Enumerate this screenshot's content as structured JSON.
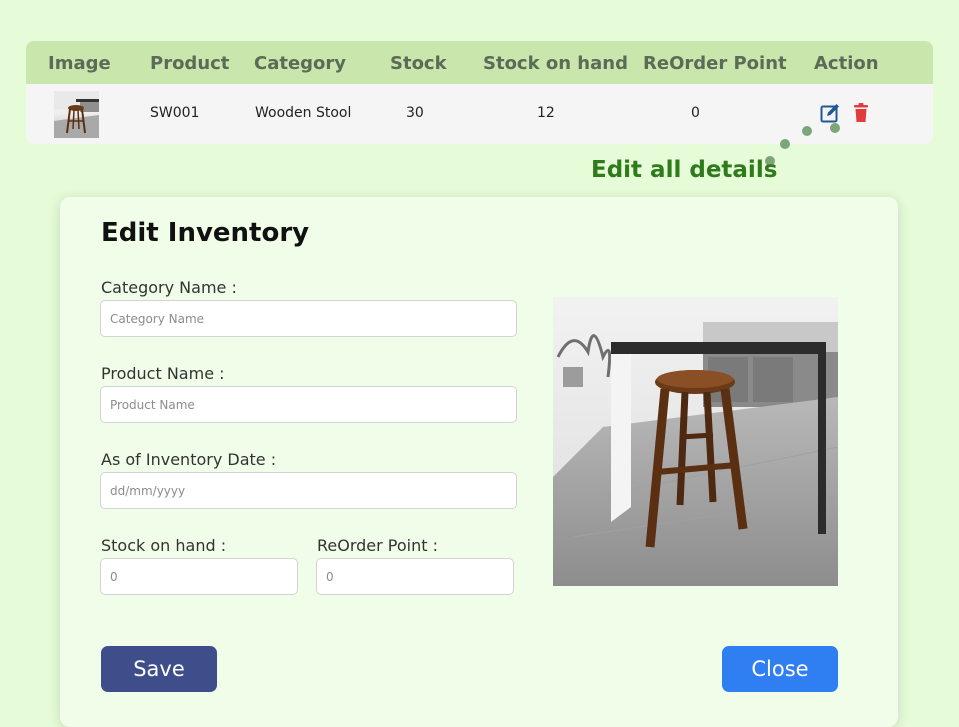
{
  "table": {
    "headers": [
      "Image",
      "Product",
      "Category",
      "Stock",
      "Stock on hand",
      "ReOrder Point",
      "Action"
    ],
    "rows": [
      {
        "product": "SW001",
        "category": "Wooden Stool",
        "stock": "30",
        "stock_on_hand": "12",
        "reorder_point": "0"
      }
    ],
    "action_icons": [
      "edit-icon",
      "trash-icon"
    ]
  },
  "annotation": {
    "text": "Edit all details",
    "color": "#2f7a1a"
  },
  "modal": {
    "title": "Edit Inventory",
    "fields": {
      "category": {
        "label": "Category Name  :",
        "placeholder": "Category Name",
        "value": ""
      },
      "product": {
        "label": "Product Name :",
        "placeholder": "Product Name",
        "value": ""
      },
      "date": {
        "label": "As of Inventory Date :",
        "placeholder": "dd/mm/yyyy",
        "value": ""
      },
      "stock_on_hand": {
        "label": "Stock on hand :",
        "placeholder": "0",
        "value": ""
      },
      "reorder_point": {
        "label": "ReOrder Point :",
        "placeholder": "0",
        "value": ""
      }
    },
    "buttons": {
      "save": "Save",
      "close": "Close"
    }
  },
  "colors": {
    "background": "#e6fbd8",
    "table_header": "#c9e6ac",
    "save_button": "#3f4d8a",
    "close_button": "#2f7ef2",
    "edit_icon": "#1f5a96",
    "delete_icon": "#e23b3b"
  }
}
